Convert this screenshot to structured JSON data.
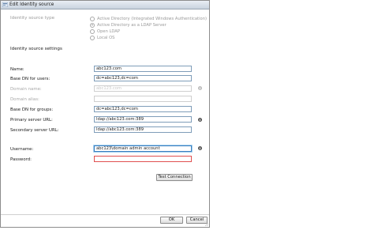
{
  "dialog": {
    "title": "Edit Identity source"
  },
  "identity_source_type": {
    "label": "Identity source type",
    "options": [
      {
        "label": "Active Directory (Integrated Windows Authentication)",
        "selected": false
      },
      {
        "label": "Active Directory as a LDAP Server",
        "selected": true
      },
      {
        "label": "Open LDAP",
        "selected": false
      },
      {
        "label": "Local OS",
        "selected": false
      }
    ]
  },
  "settings": {
    "heading": "Identity source settings",
    "name": {
      "label": "Name:",
      "value": "abc123.com"
    },
    "base_dn_users": {
      "label": "Base DN for users:",
      "value": "dc=abc123,dc=com"
    },
    "domain_name": {
      "label": "Domain name:",
      "value": "abc123.com"
    },
    "domain_alias": {
      "label": "Domain alias:",
      "value": ""
    },
    "base_dn_groups": {
      "label": "Base DN for groups:",
      "value": "dc=abc123,dc=com"
    },
    "primary_url": {
      "label": "Primary server URL:",
      "value": "ldap://abc123.com:389"
    },
    "secondary_url": {
      "label": "Secondary server URL:",
      "value": "ldap://abc123.com:389"
    },
    "username": {
      "label": "Username:",
      "value": "abc123\\domain admin account"
    },
    "password": {
      "label": "Password:",
      "value": ""
    },
    "info_icon": "info-icon"
  },
  "buttons": {
    "test_connection": "Test Connection",
    "ok": "OK",
    "cancel": "Cancel"
  },
  "colors": {
    "focus_border": "#3a7fc0",
    "error_border": "#e05050",
    "input_border": "#7f9db9"
  }
}
